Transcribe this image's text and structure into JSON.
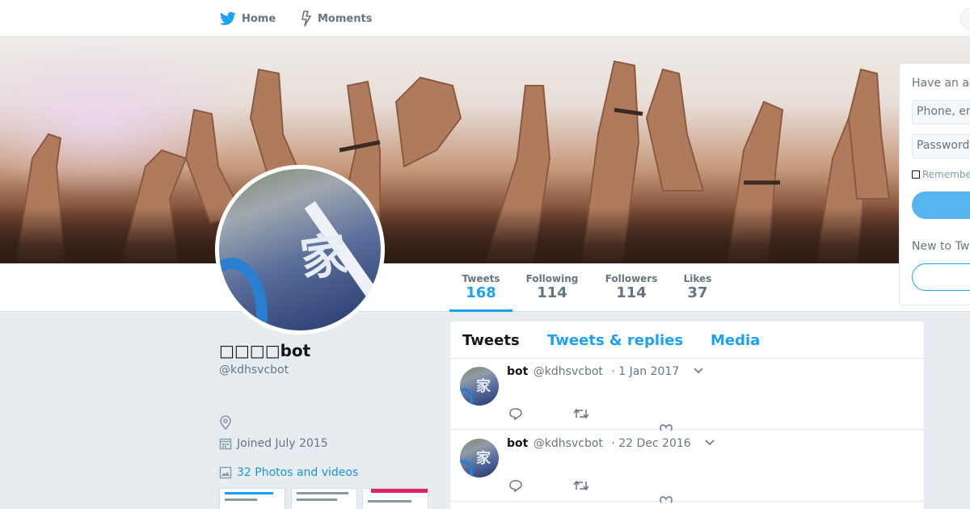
{
  "nav": {
    "home_label": "Home",
    "moments_label": "Moments"
  },
  "profile": {
    "name": "□□□□bot",
    "handle": "@kdhsvcbot",
    "avatar_kanji": "家",
    "joined": "Joined July 2015",
    "photos_link": "32 Photos and videos"
  },
  "stats": [
    {
      "label": "Tweets",
      "value": "168"
    },
    {
      "label": "Following",
      "value": "114"
    },
    {
      "label": "Followers",
      "value": "114"
    },
    {
      "label": "Likes",
      "value": "37"
    }
  ],
  "timeline": {
    "tabs": [
      "Tweets",
      "Tweets & replies",
      "Media"
    ],
    "tweets": [
      {
        "name": "bot",
        "handle": "@kdhsvcbot",
        "time": "· 1 Jan 2017"
      },
      {
        "name": "bot",
        "handle": "@kdhsvcbot",
        "time": "· 22 Dec 2016"
      }
    ]
  },
  "login": {
    "title": "Have an ac",
    "phone_placeholder": "Phone, em",
    "password_placeholder": "Password",
    "remember_label": "Remembe",
    "new_label": "New to Twi"
  },
  "colors": {
    "accent": "#1da1f2",
    "background": "#e6ecf0",
    "muted_text": "#657786"
  },
  "icons": [
    "twitter-bird-icon",
    "lightning-icon",
    "location-pin-icon",
    "calendar-icon",
    "photo-icon",
    "chevron-down-icon",
    "reply-icon",
    "retweet-icon",
    "heart-icon"
  ]
}
